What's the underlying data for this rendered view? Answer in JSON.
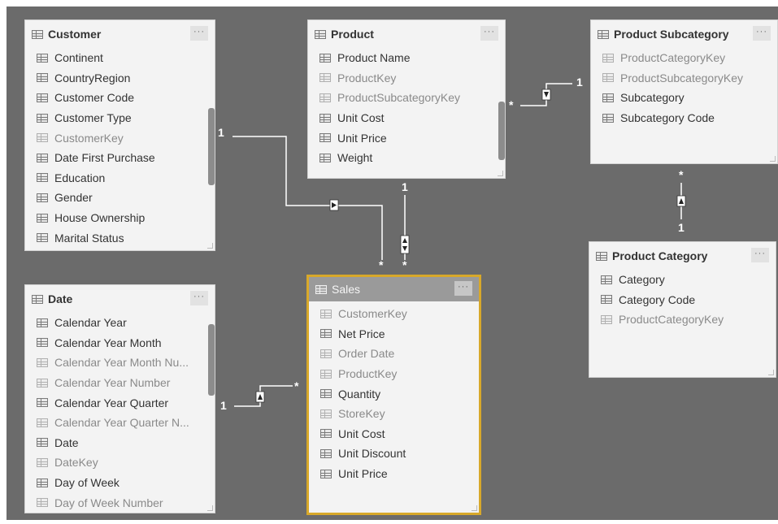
{
  "tables": {
    "customer": {
      "name": "Customer",
      "more": "···",
      "fields": [
        "Continent",
        "CountryRegion",
        "Customer Code",
        "Customer Type",
        "CustomerKey",
        "Date First Purchase",
        "Education",
        "Gender",
        "House Ownership",
        "Marital Status"
      ]
    },
    "product": {
      "name": "Product",
      "more": "···",
      "fields": [
        "Product Name",
        "ProductKey",
        "ProductSubcategoryKey",
        "Unit Cost",
        "Unit Price",
        "Weight"
      ]
    },
    "product_subcategory": {
      "name": "Product Subcategory",
      "more": "···",
      "fields": [
        "ProductCategoryKey",
        "ProductSubcategoryKey",
        "Subcategory",
        "Subcategory Code"
      ]
    },
    "product_category": {
      "name": "Product Category",
      "more": "···",
      "fields": [
        "Category",
        "Category Code",
        "ProductCategoryKey"
      ]
    },
    "date": {
      "name": "Date",
      "more": "···",
      "fields": [
        "Calendar Year",
        "Calendar Year Month",
        "Calendar Year Month Nu...",
        "Calendar Year Number",
        "Calendar Year Quarter",
        "Calendar Year Quarter N...",
        "Date",
        "DateKey",
        "Day of Week",
        "Day of Week Number"
      ]
    },
    "sales": {
      "name": "Sales",
      "more": "···",
      "fields": [
        "CustomerKey",
        "Net Price",
        "Order Date",
        "ProductKey",
        "Quantity",
        "StoreKey",
        "Unit Cost",
        "Unit Discount",
        "Unit Price"
      ]
    }
  },
  "relationships": {
    "one": "1",
    "many": "*"
  },
  "colors": {
    "canvas": "#6b6b6b",
    "selected_border": "#d8a82a",
    "card": "#f3f3f3"
  }
}
